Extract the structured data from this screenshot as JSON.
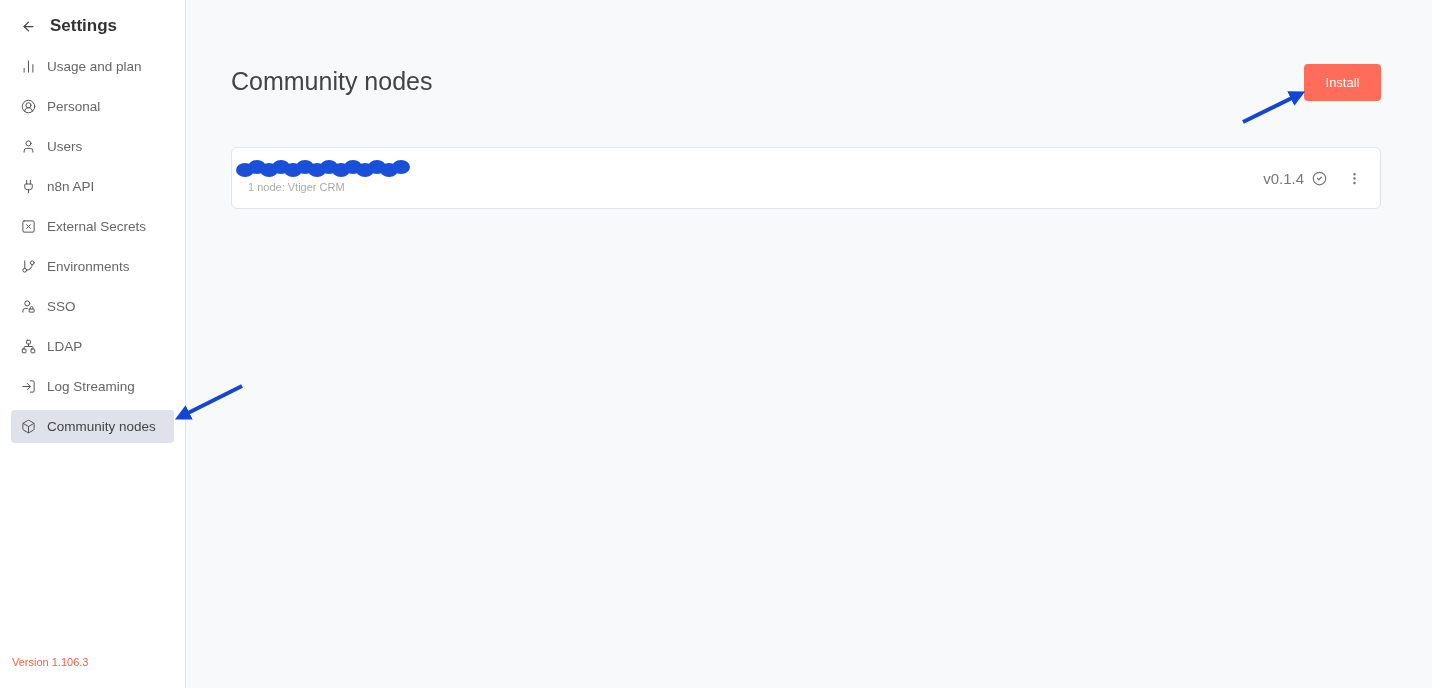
{
  "sidebar": {
    "title": "Settings",
    "items": [
      {
        "label": "Usage and plan",
        "selected": false
      },
      {
        "label": "Personal",
        "selected": false
      },
      {
        "label": "Users",
        "selected": false
      },
      {
        "label": "n8n API",
        "selected": false
      },
      {
        "label": "External Secrets",
        "selected": false
      },
      {
        "label": "Environments",
        "selected": false
      },
      {
        "label": "SSO",
        "selected": false
      },
      {
        "label": "LDAP",
        "selected": false
      },
      {
        "label": "Log Streaming",
        "selected": false
      },
      {
        "label": "Community nodes",
        "selected": true
      }
    ],
    "version": "Version 1.106.3"
  },
  "main": {
    "title": "Community nodes",
    "install_button": "Install",
    "packages": [
      {
        "subtitle": "1 node: Vtiger CRM",
        "version": "v0.1.4"
      }
    ]
  }
}
